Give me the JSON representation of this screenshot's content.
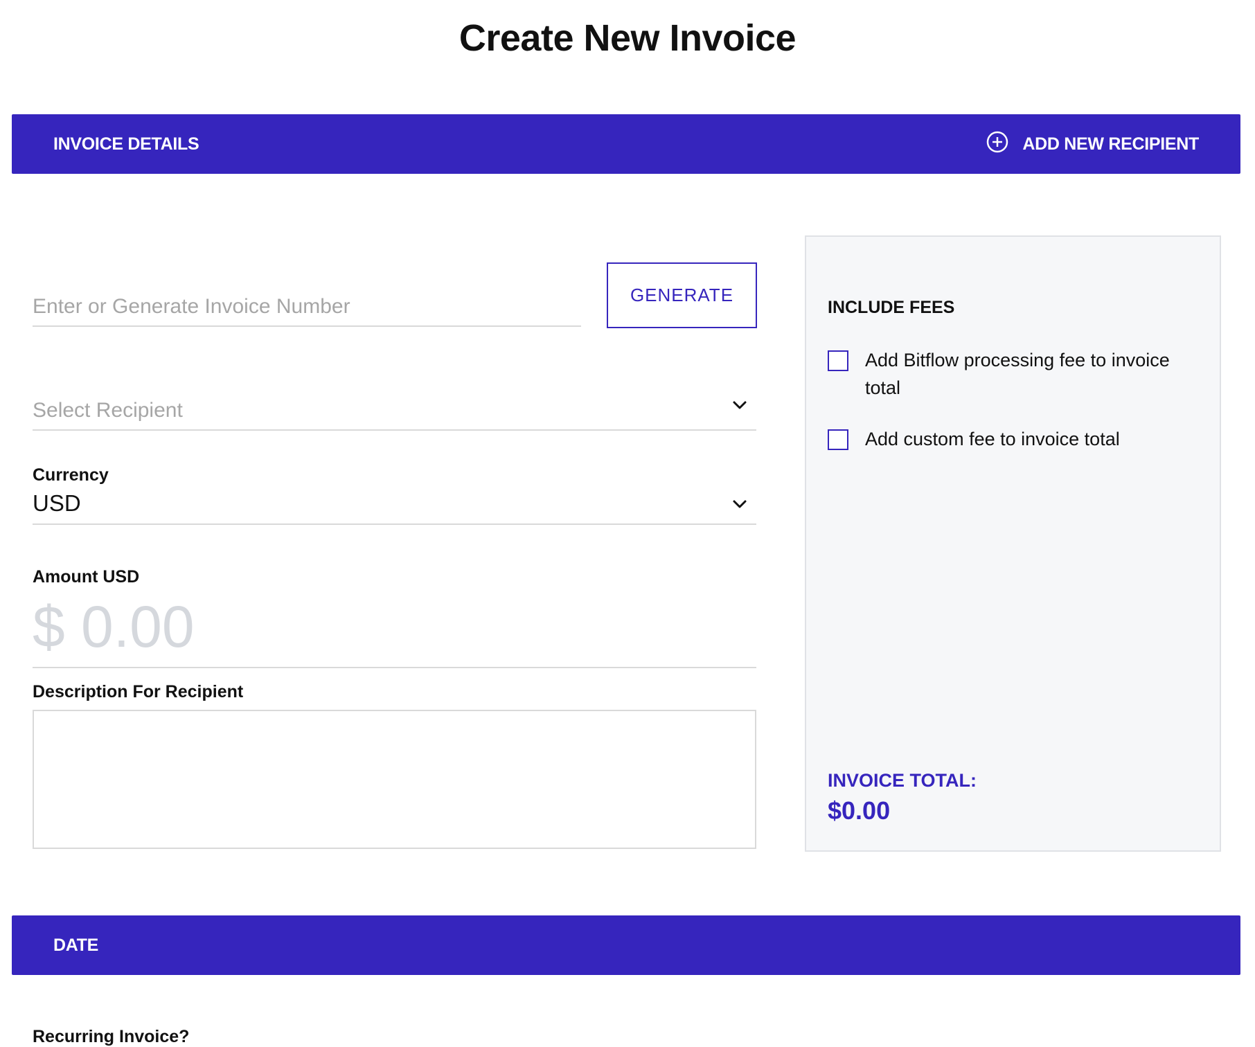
{
  "page": {
    "title": "Create New Invoice"
  },
  "invoice_details": {
    "header": "INVOICE DETAILS",
    "add_recipient_label": "ADD NEW RECIPIENT",
    "invoice_number_placeholder": "Enter or Generate Invoice Number",
    "generate_label": "GENERATE",
    "recipient_placeholder": "Select Recipient",
    "currency_label": "Currency",
    "currency_value": "USD",
    "amount_label": "Amount USD",
    "amount_value": "$ 0.00",
    "description_label": "Description For Recipient"
  },
  "fees": {
    "title": "INCLUDE FEES",
    "options": [
      {
        "label": "Add Bitflow processing fee to invoice total",
        "checked": false
      },
      {
        "label": "Add custom fee to invoice total",
        "checked": false
      }
    ],
    "total_label": "INVOICE TOTAL:",
    "total_value": "$0.00"
  },
  "date_section": {
    "header": "DATE",
    "recurring_label": "Recurring Invoice?"
  },
  "theme": {
    "accent": "#3625bd",
    "panel_bg": "#f6f7f9",
    "divider": "#d9d9d9"
  },
  "icons": {
    "add_recipient": "plus-circle-icon",
    "dropdown": "chevron-down-icon"
  }
}
